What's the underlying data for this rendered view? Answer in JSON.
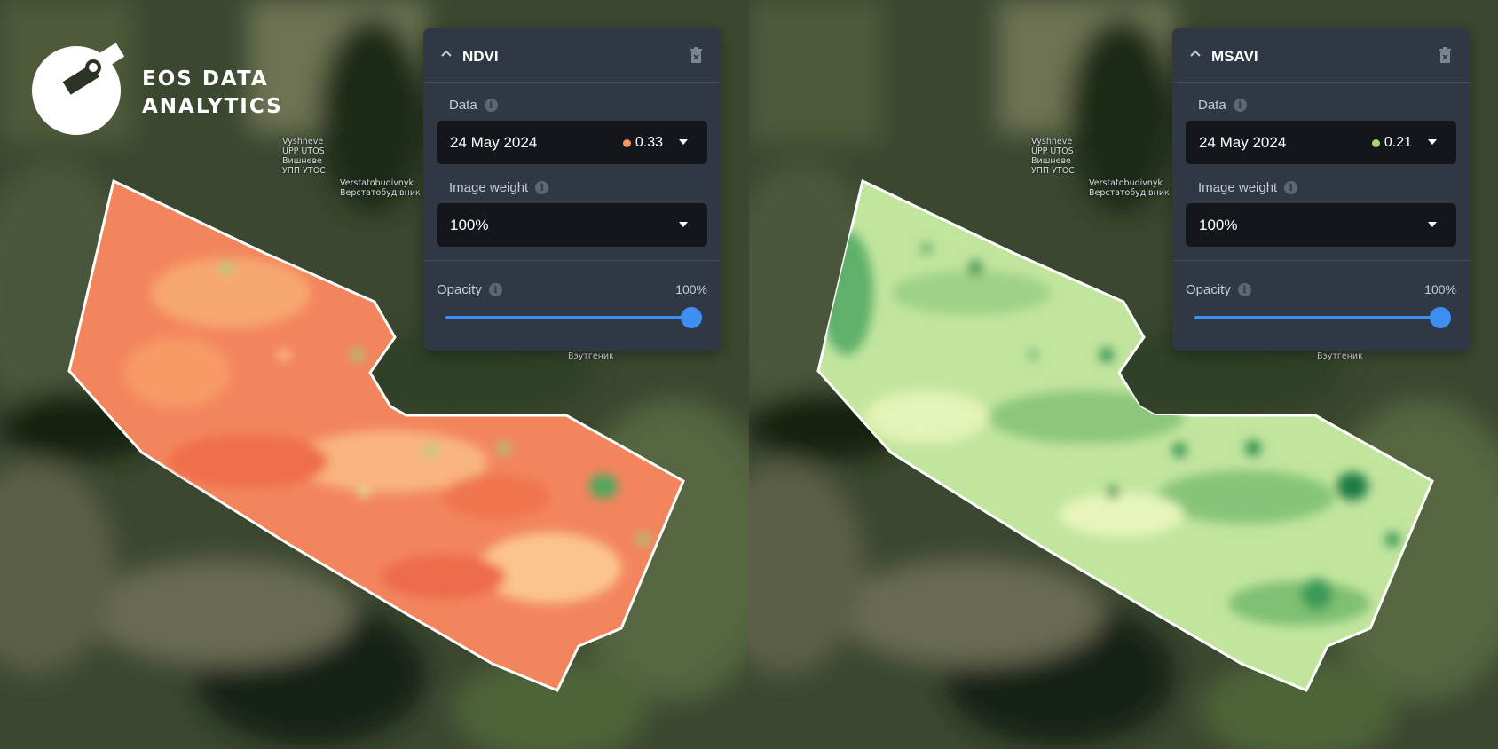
{
  "brand": {
    "line1": "EOS DATA",
    "line2": "ANALYTICS"
  },
  "map_labels": {
    "village": "Vyshneve\nUPP UTOS\nВишневе\nУПП УТОС",
    "workshop": "Verstatobudivnyk\nВерстатобудівник",
    "partial": "Вэутгеник"
  },
  "panels": [
    {
      "title": "NDVI",
      "data_label": "Data",
      "date": "24 May 2024",
      "index_value": "0.33",
      "dot_color": "#f59a5a",
      "weight_label": "Image weight",
      "weight_value": "100%",
      "opacity_label": "Opacity",
      "opacity_value": "100%",
      "opacity_level": 1.0
    },
    {
      "title": "MSAVI",
      "data_label": "Data",
      "date": "24 May 2024",
      "index_value": "0.21",
      "dot_color": "#a7d870",
      "weight_label": "Image weight",
      "weight_value": "100%",
      "opacity_label": "Opacity",
      "opacity_value": "100%",
      "opacity_level": 1.0
    }
  ],
  "colors": {
    "ndvi_fill": "#f28a5e",
    "msavi_fill": "#bfe49a",
    "panel_bg": "#2f3844",
    "accent": "#3e8ff2"
  }
}
